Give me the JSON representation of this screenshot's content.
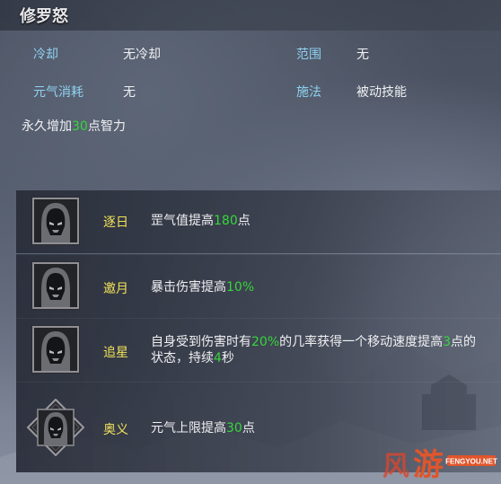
{
  "skill": {
    "title": "修罗怒",
    "attrs": {
      "cooldown_label": "冷却",
      "cooldown_value": "无冷却",
      "range_label": "范围",
      "range_value": "无",
      "cost_label": "元气消耗",
      "cost_value": "无",
      "cast_label": "施法",
      "cast_value": "被动技能"
    },
    "permanent": {
      "pre": "永久增加",
      "num": "30",
      "post": "点智力"
    }
  },
  "nodes": [
    {
      "name": "逐日",
      "parts": [
        {
          "t": "罡气值提高",
          "hl": false
        },
        {
          "t": "180",
          "hl": true
        },
        {
          "t": "点",
          "hl": false
        }
      ]
    },
    {
      "name": "邀月",
      "parts": [
        {
          "t": "暴击伤害提高",
          "hl": false
        },
        {
          "t": "10%",
          "hl": true
        }
      ]
    },
    {
      "name": "追星",
      "parts": [
        {
          "t": "自身受到伤害时有",
          "hl": false
        },
        {
          "t": "20%",
          "hl": true
        },
        {
          "t": "的几率获得一个移动速度提高",
          "hl": false
        },
        {
          "t": "3",
          "hl": true
        },
        {
          "t": "点的状态，持续",
          "hl": false
        },
        {
          "t": "4",
          "hl": true
        },
        {
          "t": "秒",
          "hl": false
        }
      ]
    },
    {
      "name": "奥义",
      "parts": [
        {
          "t": "元气上限提高",
          "hl": false
        },
        {
          "t": "30",
          "hl": true
        },
        {
          "t": "点",
          "hl": false
        }
      ]
    }
  ],
  "logo": {
    "main": "游",
    "prefix": "风",
    "site": "FENGYOU.NET"
  },
  "colors": {
    "highlight": "#36d63a",
    "node_name": "#f3e45a",
    "label": "#8fd1f0"
  },
  "icons": {
    "skill": "hooded-figure-icon"
  }
}
